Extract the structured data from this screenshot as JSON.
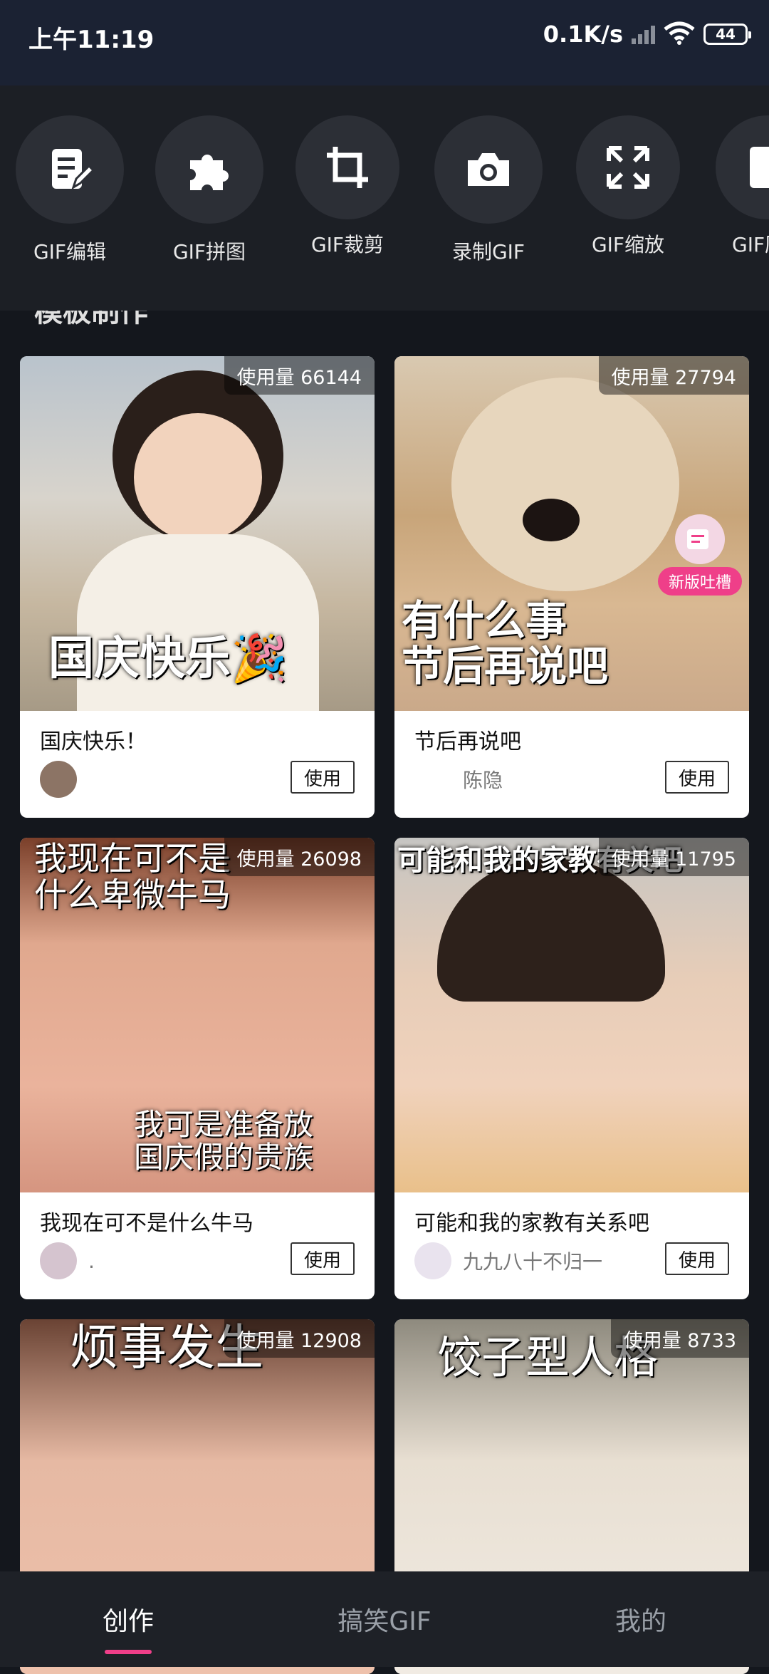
{
  "status": {
    "time": "上午11:19",
    "speed": "0.1K/s",
    "battery": "44"
  },
  "tools": [
    {
      "label": "GIF编辑",
      "icon": "edit-doc-icon"
    },
    {
      "label": "GIF拼图",
      "icon": "puzzle-icon"
    },
    {
      "label": "GIF裁剪",
      "icon": "crop-icon"
    },
    {
      "label": "录制GIF",
      "icon": "camera-icon"
    },
    {
      "label": "GIF缩放",
      "icon": "expand-icon"
    },
    {
      "label": "GIF历",
      "icon": "document-icon"
    }
  ],
  "section_title": "模板制作",
  "cards": [
    {
      "usage": "使用量 66144",
      "caption": "国庆快乐🎉",
      "title": "国庆快乐！",
      "author": "",
      "button": "使用"
    },
    {
      "usage": "使用量 27794",
      "caption": "有什么事\n节后再说吧",
      "title": "节后再说吧",
      "author": "陈隐",
      "button": "使用",
      "badge": "新版吐槽"
    },
    {
      "usage": "使用量 26098",
      "caption": "我现在可不是\n什么卑微牛马",
      "caption2": "我可是准备放\n国庆假的贵族",
      "title": "我现在可不是什么牛马",
      "author": ".",
      "button": "使用"
    },
    {
      "usage": "使用量 11795",
      "caption": "可能和我的家教有关吧",
      "title": "可能和我的家教有关系吧",
      "author": "九九八十不归一",
      "button": "使用"
    },
    {
      "usage": "使用量 12908",
      "caption": "烦事发生"
    },
    {
      "usage": "使用量 8733",
      "caption": "饺子型人格"
    }
  ],
  "nav": [
    {
      "label": "创作",
      "active": true
    },
    {
      "label": "搞笑GIF",
      "active": false
    },
    {
      "label": "我的",
      "active": false
    }
  ],
  "colors": {
    "accent": "#ef3f89",
    "background": "#14171d"
  }
}
